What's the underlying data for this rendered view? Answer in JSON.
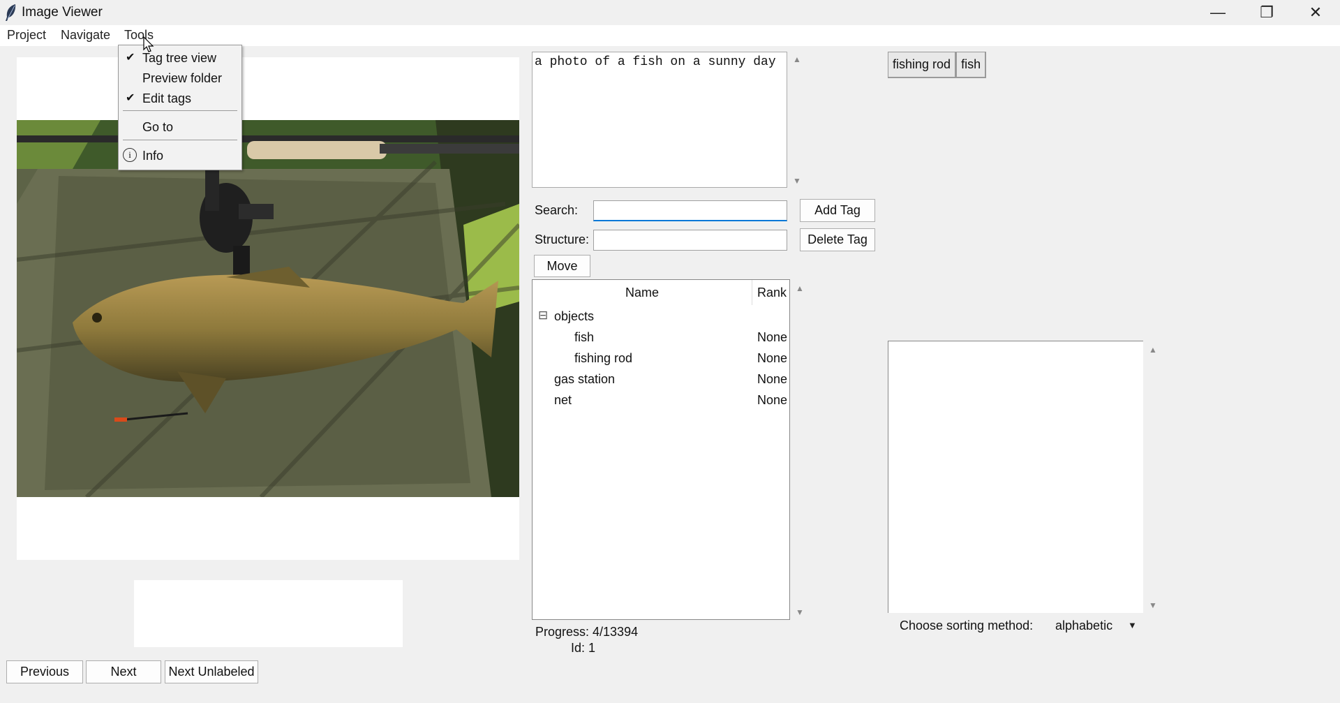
{
  "window": {
    "title": "Image Viewer",
    "controls": {
      "minimize": "—",
      "maximize": "❐",
      "close": "✕"
    }
  },
  "menubar": {
    "items": [
      "Project",
      "Navigate",
      "Tools"
    ]
  },
  "tools_menu": {
    "items": [
      {
        "label": "Tag tree view",
        "checked": true
      },
      {
        "label": "Preview folder",
        "checked": false
      },
      {
        "label": "Edit tags",
        "checked": true
      },
      {
        "label": "Go to",
        "checked": false
      },
      {
        "label": "Info",
        "icon": "info-icon"
      }
    ],
    "check_glyph": "✔",
    "info_glyph": "i"
  },
  "caption": {
    "text": "a photo of a fish on a sunny day"
  },
  "search": {
    "label": "Search:",
    "value": ""
  },
  "structure": {
    "label": "Structure:",
    "value": ""
  },
  "buttons": {
    "add_tag": "Add Tag",
    "delete_tag": "Delete Tag",
    "move": "Move",
    "previous": "Previous",
    "next": "Next",
    "next_unlabeled": "Next Unlabeled"
  },
  "tree": {
    "columns": [
      "Name",
      "Rank"
    ],
    "expander": "⊟",
    "rows": [
      {
        "name": "objects",
        "rank": "",
        "level": 0,
        "expanded": true
      },
      {
        "name": "fish",
        "rank": "None",
        "level": 1
      },
      {
        "name": "fishing rod",
        "rank": "None",
        "level": 1
      },
      {
        "name": "gas station",
        "rank": "None",
        "level": 0
      },
      {
        "name": "net",
        "rank": "None",
        "level": 0
      }
    ]
  },
  "status": {
    "progress": "Progress: 4/13394",
    "id": "Id: 1"
  },
  "applied_tags": [
    "fishing rod",
    "fish"
  ],
  "sorting": {
    "label": "Choose sorting method:",
    "value": "alphabetic",
    "arrow": "▼"
  },
  "scroll_arrows": {
    "up": "▲",
    "down": "▼"
  },
  "colors": {
    "background": "#f0f0f0",
    "entry_focus": "#0078d7"
  }
}
